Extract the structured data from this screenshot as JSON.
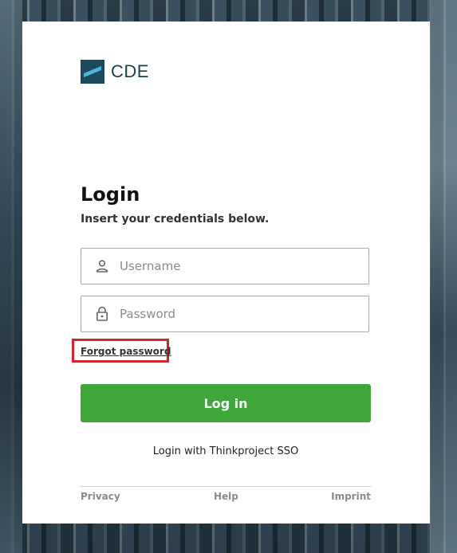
{
  "brand": {
    "name": "CDE",
    "color": "#1c4a5c"
  },
  "login": {
    "title": "Login",
    "subtitle": "Insert your credentials below.",
    "username": {
      "placeholder": "Username",
      "value": "",
      "icon": "user-icon"
    },
    "password": {
      "placeholder": "Password",
      "value": "",
      "icon": "lock-icon"
    },
    "forgot_label": "Forgot password",
    "submit_label": "Log in",
    "submit_color": "#3fa73a",
    "sso_label": "Login with Thinkproject SSO"
  },
  "footer": {
    "privacy": "Privacy",
    "help": "Help",
    "imprint": "Imprint"
  },
  "highlight": {
    "color": "#d0262c"
  }
}
